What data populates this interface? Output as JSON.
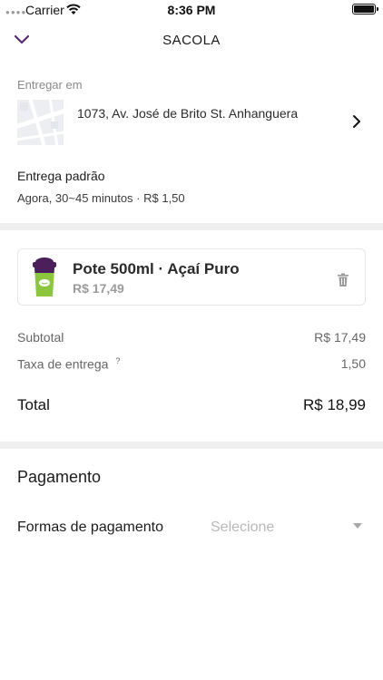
{
  "status_bar": {
    "carrier": "Carrier",
    "time": "8:36 PM"
  },
  "header": {
    "title": "SACOLA",
    "back_icon": "chevron-down-icon"
  },
  "delivery": {
    "label": "Entregar em",
    "address": "1073, Av. José de Brito St. Anhanguera",
    "shipping_title": "Entrega padrão",
    "shipping_detail": "Agora, 30~45 minutos · R$ 1,50"
  },
  "cart": {
    "items": [
      {
        "name": "Pote 500ml · Açaí Puro",
        "price": "R$ 17,49",
        "icon": "acai-cup-icon"
      }
    ]
  },
  "summary": {
    "subtotal_label": "Subtotal",
    "subtotal_value": "R$ 17,49",
    "fee_label": "Taxa de entrega",
    "fee_help": "?",
    "fee_value": "1,50",
    "total_label": "Total",
    "total_value": "R$ 18,99"
  },
  "payment": {
    "title": "Pagamento",
    "methods_label": "Formas de pagamento",
    "select_placeholder": "Selecione"
  },
  "colors": {
    "accent": "#5a2d6e",
    "separator": "#efefef",
    "cup_lid": "#4b1f5c",
    "cup_body": "#8cc63f"
  }
}
